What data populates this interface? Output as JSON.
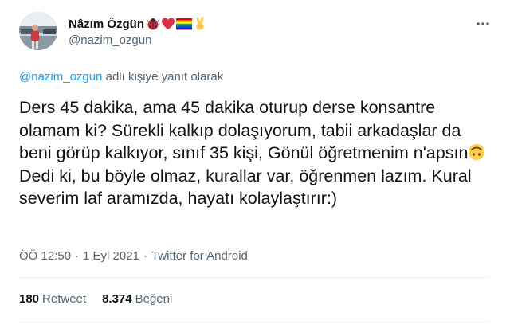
{
  "author": {
    "display_name": "Nâzım Özgün",
    "username": "@nazim_ozgun",
    "name_emojis": [
      "ladybug-emoji",
      "red-heart-emoji",
      "rainbow-flag-emoji",
      "victory-hand-emoji"
    ]
  },
  "reply_context": {
    "mention": "@nazim_ozgun",
    "text": " adlı kişiye yanıt olarak"
  },
  "tweet": {
    "text_part1": "Ders 45 dakika, ama 45 dakika oturup derse konsantre olamam ki? Sürekli kalkıp dolaşıyorum, tabii arkadaşlar da beni görüp kalkıyor, sınıf 35 kişi, Gönül öğretmenim n'apsın",
    "inline_emoji": "upside-down-face-emoji",
    "text_part2": " Dedi ki, bu böyle olmaz, kurallar var, öğrenmen lazım. Kural severim laf aramızda, hayatı kolaylaştırır:)"
  },
  "meta": {
    "time": "ÖÖ 12:50",
    "separator": "·",
    "date": "1 Eyl 2021",
    "source": "Twitter for Android"
  },
  "stats": {
    "retweets_count": "180",
    "retweets_label": "Retweet",
    "likes_count": "8.374",
    "likes_label": "Beğeni"
  },
  "colors": {
    "text": "#0f1419",
    "secondary": "#536471",
    "link": "#1d9bf0",
    "divider": "#eff3f4"
  }
}
